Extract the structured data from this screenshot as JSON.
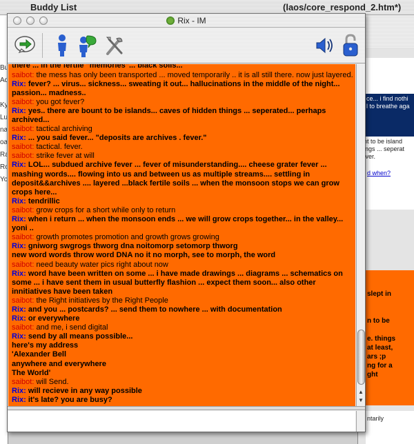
{
  "background": {
    "buddy_list_title": "Buddy List",
    "editor_title": "(laos/core_respond_2.htm*)",
    "left_letters": [
      "Bu",
      "Ad",
      "",
      "Ky",
      "Lu",
      "na",
      "oa",
      "Ra",
      "Ro",
      "Yo"
    ],
    "right_top_lines": [
      "ce... i find nothi",
      "l to breathe aga",
      "",
      "unt to be island",
      "hings ... seperat",
      "fever."
    ],
    "right_link": "d when?",
    "right_orange_lines": [
      "",
      "",
      "slept in",
      "",
      "",
      "n to be",
      "",
      "e. things",
      "at least,",
      "ars ;p",
      "ng for a",
      "ght"
    ],
    "right_bottom_text": "ntarily"
  },
  "window": {
    "title": "Rix - IM"
  },
  "toolbar": {
    "icons": [
      "send-message-icon",
      "buddy-info-icon",
      "warn-buddy-icon",
      "preferences-icon",
      "volume-icon",
      "secure-lock-icon"
    ]
  },
  "chat": {
    "messages": [
      {
        "type": "rix",
        "nick": "",
        "text": "there ... in the fertile \"memories\"... black soils..."
      },
      {
        "type": "saibot",
        "nick": "saibot:",
        "text": "the mess has only been transported ... moved temporarily .. it is all still there. now just layered."
      },
      {
        "type": "rix",
        "nick": "Rix:",
        "text": "fever? ... virus... sickness... sweating it out... hallucinations in the middle of the night... passion... madness.."
      },
      {
        "type": "saibot",
        "nick": "saibot:",
        "text": "you got fever?"
      },
      {
        "type": "rix",
        "nick": "Rix:",
        "text": "yes.. there are bount to be islands... caves of hidden things ... seperated... perhaps archived..."
      },
      {
        "type": "saibot",
        "nick": "saibot:",
        "text": "tactical archiving"
      },
      {
        "type": "rix",
        "nick": "Rix:",
        "text": "... you said fever... \"deposits are archives . fever.\""
      },
      {
        "type": "saibot",
        "nick": "saibot:",
        "text": "tactical. fever."
      },
      {
        "type": "saibot",
        "nick": "saibot:",
        "text": "strike fever at will"
      },
      {
        "type": "rix",
        "nick": "Rix:",
        "text": "LOL... subdued archive fever ... fever of misunderstanding.... cheese grater fever ... mashing words.... flowing into us and between us as multiple streams.... settling in deposit&&archives .... layered ...black fertile soils ... when the monsoon stops we can grow crops here..."
      },
      {
        "type": "rix",
        "nick": "Rix:",
        "text": "tendrillic"
      },
      {
        "type": "saibot",
        "nick": "saibot:",
        "text": "grow crops for a short while only to return"
      },
      {
        "type": "rix",
        "nick": "Rix:",
        "text": "when i return ... when the monsoon ends ... we will grow crops together... in the valley... yoni .."
      },
      {
        "type": "saibot",
        "nick": "saibot:",
        "text": "growth promotes promotion and growth grows growing"
      },
      {
        "type": "rix",
        "nick": "Rix:",
        "text": "gniworg swgrogs thworg dna noitomorp setomorp thworg"
      },
      {
        "type": "plain",
        "nick": "",
        "text": "new word words throw word DNA no it no morph, see to morph, the word"
      },
      {
        "type": "saibot",
        "nick": "saibot:",
        "text": "need beauty water pics right about now"
      },
      {
        "type": "rix",
        "nick": "Rix:",
        "text": "word have been written on some ... i have made drawings ... diagrams ... schematics on some ... i have sent them in usual butterfly flashion ... expect them soon... also other innitiatives have been taken"
      },
      {
        "type": "saibot",
        "nick": "saibot:",
        "text": "the Right initiatives by the Right People"
      },
      {
        "type": "rix",
        "nick": "Rix:",
        "text": "and you ... postcards? ... send them to nowhere ... with documentation"
      },
      {
        "type": "rix",
        "nick": "Rix:",
        "text": "or everywhere"
      },
      {
        "type": "saibot",
        "nick": "saibot:",
        "text": "and me, i send digital"
      },
      {
        "type": "rix",
        "nick": "Rix:",
        "text": "send by all means possible..."
      },
      {
        "type": "plain",
        "nick": "",
        "text": "here's my address"
      },
      {
        "type": "plain",
        "nick": "",
        "text": " "
      },
      {
        "type": "plain",
        "nick": "",
        "text": "'Alexander Bell"
      },
      {
        "type": "plain",
        "nick": "",
        "text": "anywhere and everywhere"
      },
      {
        "type": "plain",
        "nick": "",
        "text": "The World'"
      },
      {
        "type": "saibot",
        "nick": "saibot:",
        "text": "will Send."
      },
      {
        "type": "rix",
        "nick": "Rix:",
        "text": "will recieve in any way possible"
      },
      {
        "type": "rix",
        "nick": "Rix:",
        "text": "it's late? you are busy?"
      }
    ]
  },
  "input": {
    "value": ""
  },
  "colors": {
    "chat_background": "#ff6a00",
    "rix_nick": "#0000d8",
    "saibot_nick": "#cc0000"
  }
}
